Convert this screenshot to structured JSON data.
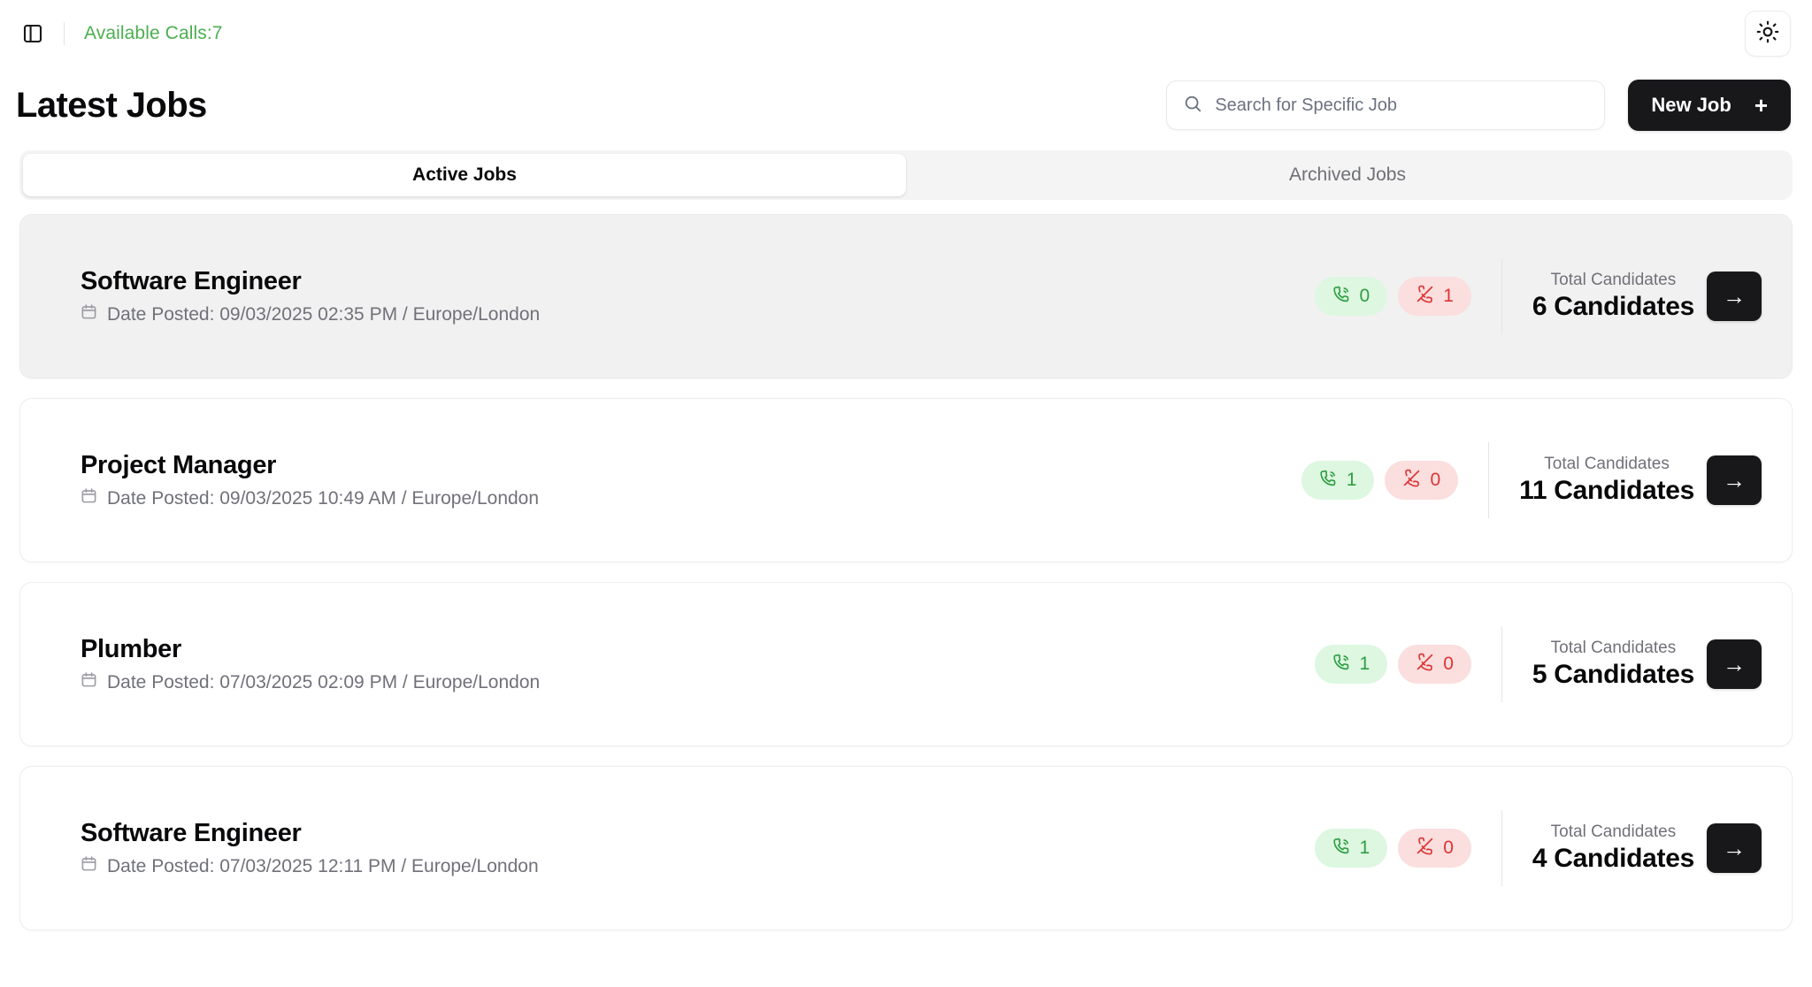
{
  "topbar": {
    "panel_toggle_icon": "panel-left-icon",
    "available_calls": "Available Calls:7",
    "theme_toggle_icon": "sun-icon",
    "accent_green": "#4caf50"
  },
  "header": {
    "title": "Latest Jobs",
    "search": {
      "placeholder": "Search for Specific Job",
      "value": "",
      "icon": "search-icon"
    },
    "new_job": {
      "label": "New Job",
      "plus": "+"
    }
  },
  "tabs": {
    "items": [
      {
        "label": "Active Jobs",
        "active": true
      },
      {
        "label": "Archived Jobs",
        "active": false
      }
    ]
  },
  "jobs": {
    "total_candidates_label": "Total Candidates",
    "arrow_glyph": "→",
    "calendar_icon": "calendar-icon",
    "answered_icon": "phone-call-icon",
    "missed_icon": "phone-off-icon",
    "items": [
      {
        "title": "Software Engineer",
        "date_text": "Date Posted: 09/03/2025 02:35 PM / Europe/London",
        "answered_count": "0",
        "missed_count": "1",
        "candidates": "6 Candidates",
        "hovered": true
      },
      {
        "title": "Project Manager",
        "date_text": "Date Posted: 09/03/2025 10:49 AM / Europe/London",
        "answered_count": "1",
        "missed_count": "0",
        "candidates": "11 Candidates",
        "hovered": false
      },
      {
        "title": "Plumber",
        "date_text": "Date Posted: 07/03/2025 02:09 PM / Europe/London",
        "answered_count": "1",
        "missed_count": "0",
        "candidates": "5 Candidates",
        "hovered": false
      },
      {
        "title": "Software Engineer",
        "date_text": "Date Posted: 07/03/2025 12:11 PM / Europe/London",
        "answered_count": "1",
        "missed_count": "0",
        "candidates": "4 Candidates",
        "hovered": false
      }
    ]
  }
}
